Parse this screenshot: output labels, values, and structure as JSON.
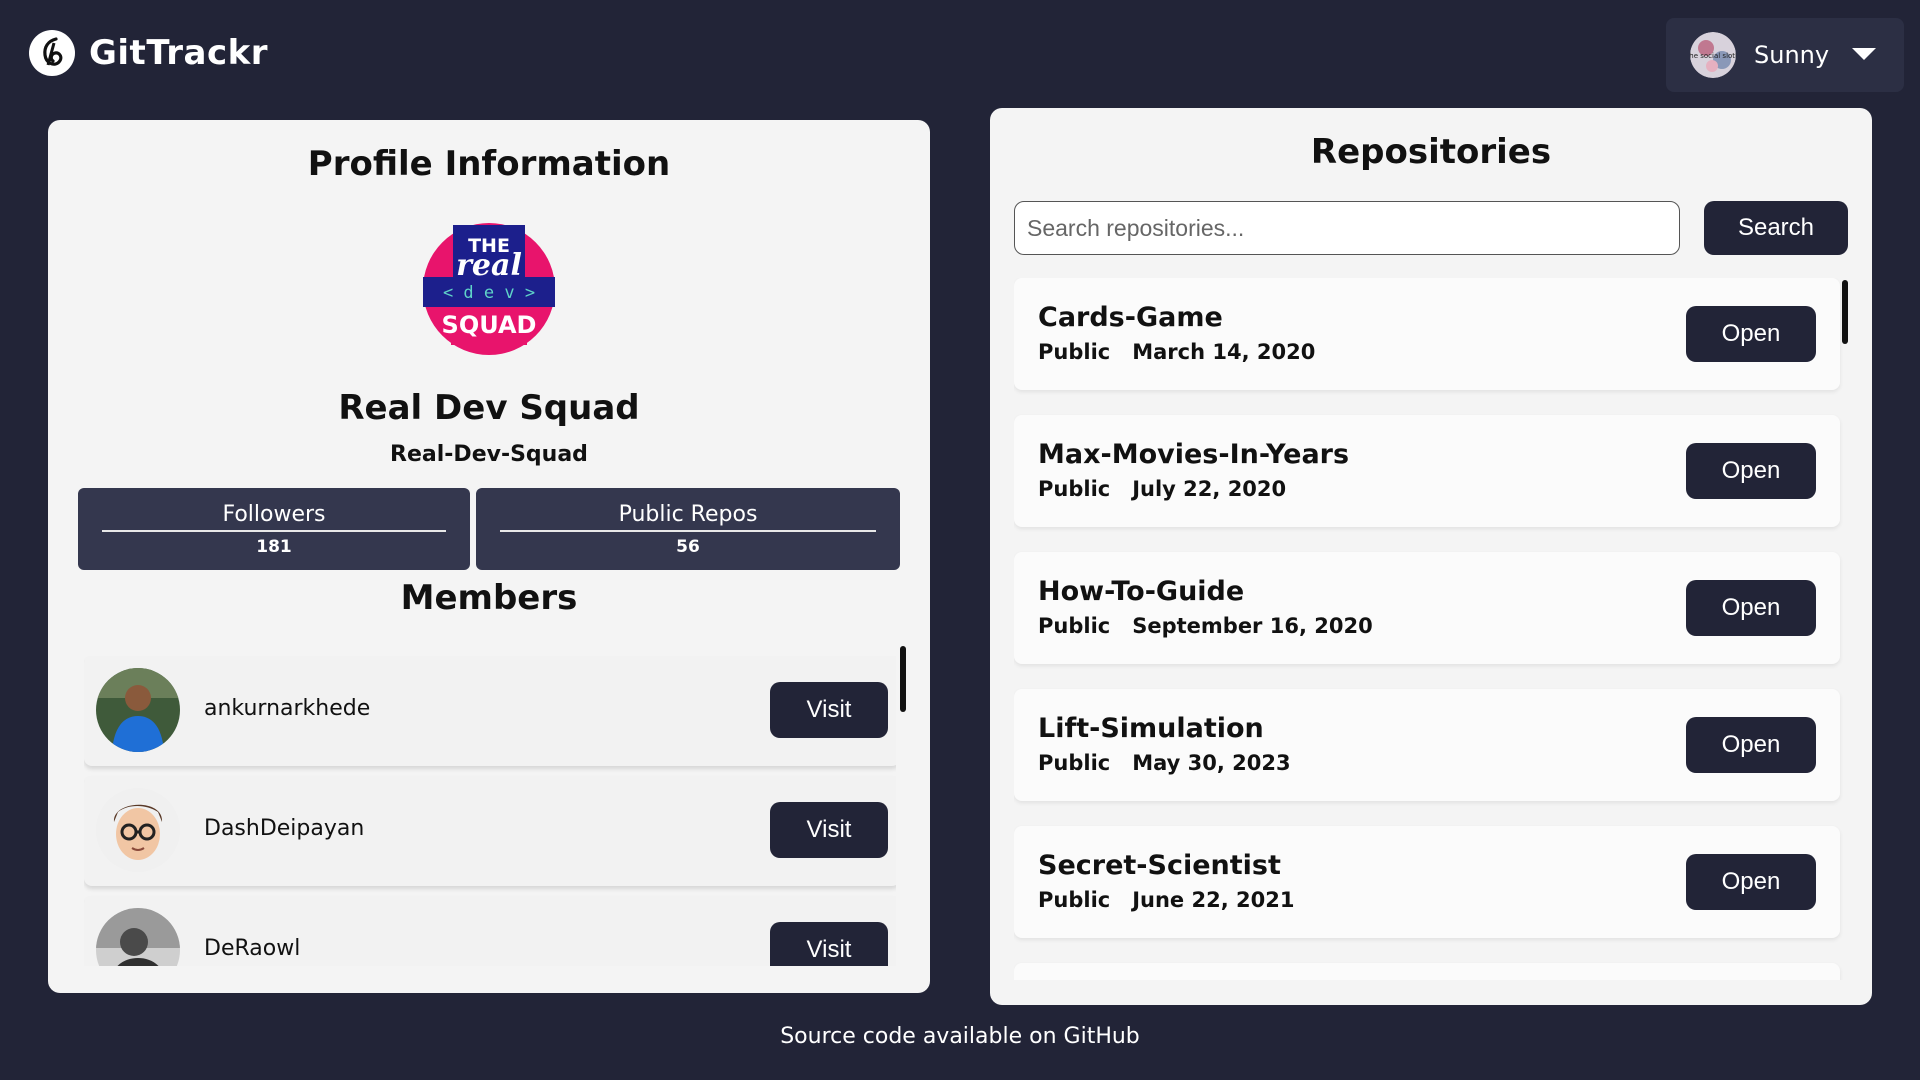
{
  "header": {
    "app_name": "GitTrackr",
    "logo_icon": "github-icon",
    "user": {
      "name": "Sunny",
      "avatar_text": "the social sloth",
      "caret_icon": "caret-down-icon"
    }
  },
  "profile": {
    "title": "Profile Information",
    "org_logo": {
      "line1": "THE",
      "line2": "real",
      "line3": "< d e v >",
      "line4": "SQUAD"
    },
    "org_name": "Real Dev Squad",
    "org_login": "Real-Dev-Squad",
    "stats": [
      {
        "label": "Followers",
        "value": "181"
      },
      {
        "label": "Public Repos",
        "value": "56"
      }
    ],
    "members_title": "Members",
    "visit_label": "Visit",
    "members": [
      {
        "login": "ankurnarkhede"
      },
      {
        "login": "DashDeipayan"
      },
      {
        "login": "DeRaowl"
      }
    ]
  },
  "repositories": {
    "title": "Repositories",
    "search_placeholder": "Search repositories...",
    "search_label": "Search",
    "open_label": "Open",
    "items": [
      {
        "name": "Cards-Game",
        "visibility": "Public",
        "date": "March 14, 2020"
      },
      {
        "name": "Max-Movies-In-Years",
        "visibility": "Public",
        "date": "July 22, 2020"
      },
      {
        "name": "How-To-Guide",
        "visibility": "Public",
        "date": "September 16, 2020"
      },
      {
        "name": "Lift-Simulation",
        "visibility": "Public",
        "date": "May 30, 2023"
      },
      {
        "name": "Secret-Scientist",
        "visibility": "Public",
        "date": "June 22, 2021"
      }
    ]
  },
  "footer": {
    "text": "Source code available on",
    "link": "GitHub"
  },
  "colors": {
    "background": "#222437",
    "panel": "#f4f4f4",
    "button": "#222437",
    "org_logo_pink": "#e8146c",
    "org_logo_blue": "#1c1f8c"
  }
}
